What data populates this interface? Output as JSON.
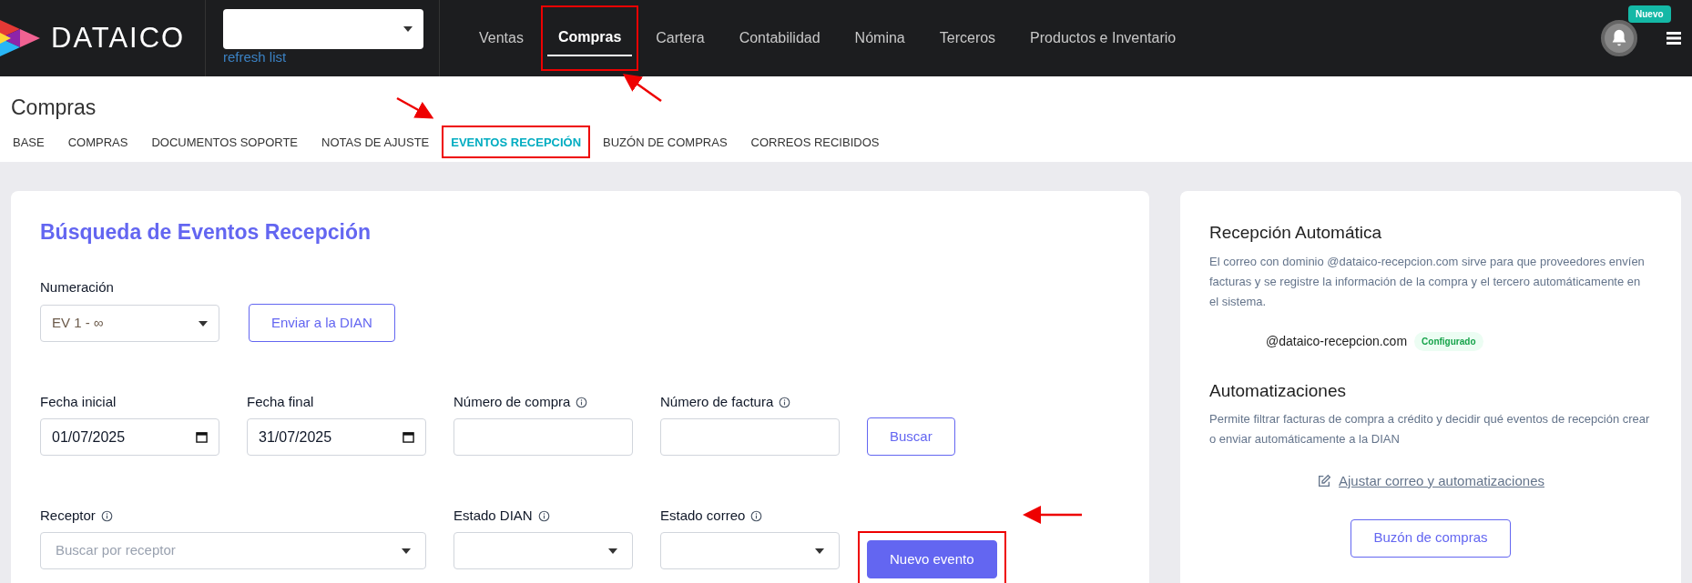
{
  "header": {
    "logo_text": "DATAICO",
    "refresh_link": "refresh list",
    "badge": "Nuevo",
    "nav": [
      {
        "label": "Ventas",
        "selected": false,
        "highlighted": false
      },
      {
        "label": "Compras",
        "selected": true,
        "highlighted": true
      },
      {
        "label": "Cartera",
        "selected": false,
        "highlighted": false
      },
      {
        "label": "Contabilidad",
        "selected": false,
        "highlighted": false
      },
      {
        "label": "Nómina",
        "selected": false,
        "highlighted": false
      },
      {
        "label": "Terceros",
        "selected": false,
        "highlighted": false
      },
      {
        "label": "Productos e Inventario",
        "selected": false,
        "highlighted": false
      }
    ]
  },
  "page_title": "Compras",
  "tabs": [
    {
      "label": "BASE",
      "selected": false,
      "highlighted": false
    },
    {
      "label": "COMPRAS",
      "selected": false,
      "highlighted": false
    },
    {
      "label": "DOCUMENTOS SOPORTE",
      "selected": false,
      "highlighted": false
    },
    {
      "label": "NOTAS DE AJUSTE",
      "selected": false,
      "highlighted": false
    },
    {
      "label": "EVENTOS RECEPCIÓN",
      "selected": true,
      "highlighted": true
    },
    {
      "label": "BUZÓN DE COMPRAS",
      "selected": false,
      "highlighted": false
    },
    {
      "label": "CORREOS RECIBIDOS",
      "selected": false,
      "highlighted": false
    }
  ],
  "search_card": {
    "title": "Búsqueda de Eventos Recepción",
    "numeracion": {
      "label": "Numeración",
      "value": "EV 1 - ∞"
    },
    "send_button": {
      "label": "Enviar a la DIAN",
      "highlighted": false
    },
    "rows": [
      {
        "fields": [
          {
            "kind": "date",
            "label": "Fecha inicial",
            "value": "01/07/2025",
            "info": false,
            "wide": false
          },
          {
            "kind": "date",
            "label": "Fecha final",
            "value": "31/07/2025",
            "info": false,
            "wide": false
          },
          {
            "kind": "text",
            "label": "Número de compra",
            "info": true,
            "wide": false
          },
          {
            "kind": "text",
            "label": "Número de factura",
            "info": true,
            "wide": false
          }
        ],
        "button": {
          "label": "Buscar",
          "kind": "outline",
          "highlighted": false
        }
      },
      {
        "fields": [
          {
            "kind": "select",
            "label": "Receptor",
            "placeholder": "Buscar por receptor",
            "info": true,
            "wide": true
          },
          {
            "kind": "select",
            "label": "Estado DIAN",
            "info": true,
            "wide": false
          },
          {
            "kind": "select",
            "label": "Estado correo",
            "info": true,
            "wide": false
          }
        ],
        "button": {
          "label": "Nuevo evento",
          "kind": "solid",
          "highlighted": true
        }
      }
    ]
  },
  "side_card": {
    "title": "Recepción Automática",
    "description": "El correo con dominio @dataico-recepcion.com sirve para que proveedores envíen facturas y se registre la información de la compra y el tercero automáticamente en el sistema.",
    "email": "@dataico-recepcion.com",
    "status": "Configurado",
    "automation_title": "Automatizaciones",
    "automation_description": "Permite filtrar facturas de compra a crédito y decidir qué eventos de recepción crear o enviar automáticamente a la DIAN",
    "settings_link": "Ajustar correo y automatizaciones",
    "mailbox_button": "Buzón de compras"
  }
}
